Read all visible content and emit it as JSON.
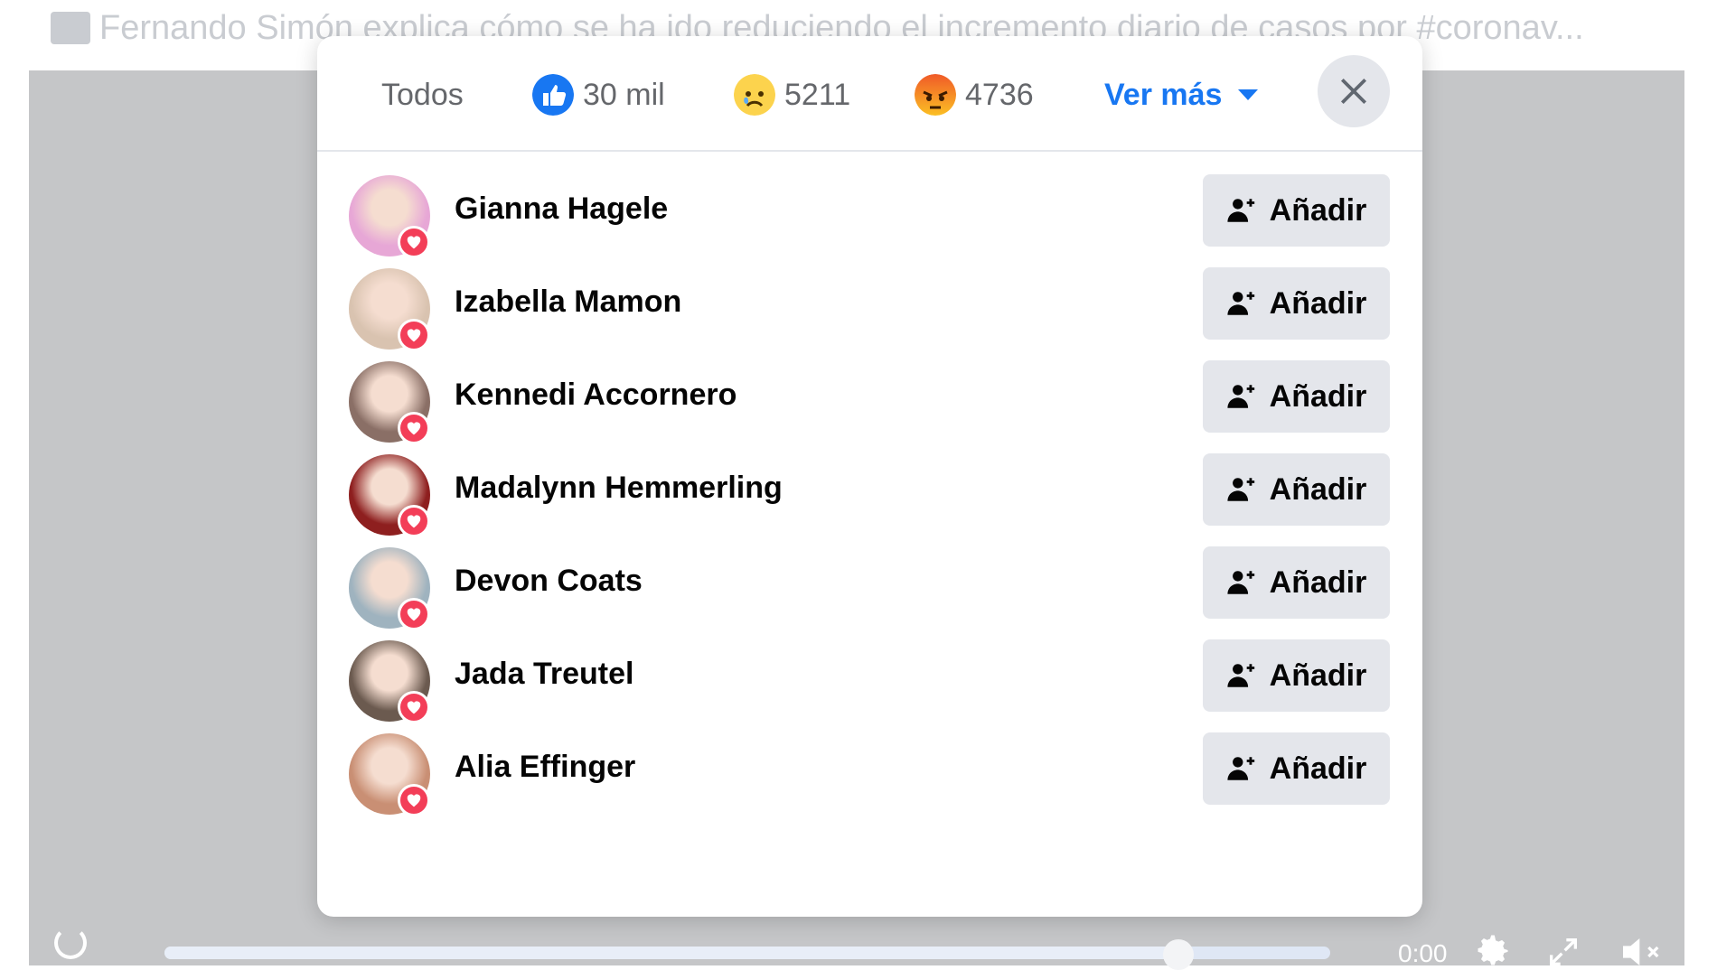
{
  "post": {
    "title": "Fernando Simón explica cómo se ha ido reduciendo el incremento diario de casos por #coronav..."
  },
  "player": {
    "time": "0:00",
    "progress": 0.87
  },
  "modal": {
    "tabs": {
      "all": "Todos",
      "like": "30 mil",
      "sad": "5211",
      "angry": "4736",
      "more": "Ver más"
    },
    "add_label": "Añadir",
    "people": [
      {
        "name": "Gianna Hagele",
        "avatar_color": "#e7a7d6"
      },
      {
        "name": "Izabella Mamon",
        "avatar_color": "#d9c3b0"
      },
      {
        "name": "Kennedi Accornero",
        "avatar_color": "#8a6f66"
      },
      {
        "name": "Madalynn Hemmerling",
        "avatar_color": "#8e1f1f"
      },
      {
        "name": "Devon Coats",
        "avatar_color": "#9fb3bf"
      },
      {
        "name": "Jada Treutel",
        "avatar_color": "#6b5a4f"
      },
      {
        "name": "Alia Effinger",
        "avatar_color": "#c98f74"
      }
    ]
  },
  "colors": {
    "accent": "#1877f2",
    "heart": "#f33e58",
    "button_bg": "#e4e6eb"
  }
}
